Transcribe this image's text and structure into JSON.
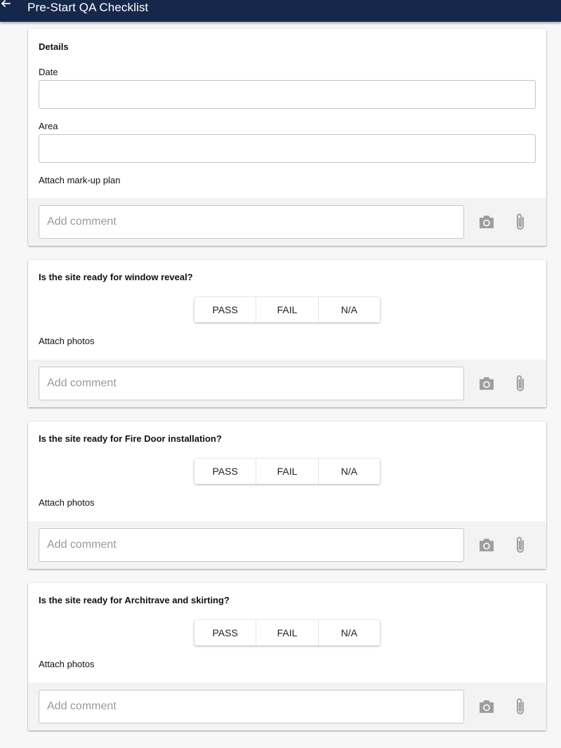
{
  "header": {
    "title": "Pre-Start QA Checklist",
    "back_icon": "arrow-left-icon"
  },
  "details": {
    "title": "Details",
    "date_label": "Date",
    "date_value": "",
    "area_label": "Area",
    "area_value": "",
    "attach_label": "Attach mark-up plan",
    "comment_placeholder": "Add comment"
  },
  "questions": [
    {
      "title": "Is the site ready for window reveal?",
      "options": [
        "PASS",
        "FAIL",
        "N/A"
      ],
      "attach_label": "Attach photos",
      "comment_placeholder": "Add comment"
    },
    {
      "title": "Is the site ready for Fire Door installation?",
      "options": [
        "PASS",
        "FAIL",
        "N/A"
      ],
      "attach_label": "Attach photos",
      "comment_placeholder": "Add comment"
    },
    {
      "title": "Is the site ready for Architrave and skirting?",
      "options": [
        "PASS",
        "FAIL",
        "N/A"
      ],
      "attach_label": "Attach photos",
      "comment_placeholder": "Add comment"
    }
  ],
  "icons": {
    "camera": "camera-icon",
    "attach": "paperclip-icon"
  },
  "colors": {
    "header_bg": "#15284b",
    "icon_gray": "#9e9e9e"
  }
}
